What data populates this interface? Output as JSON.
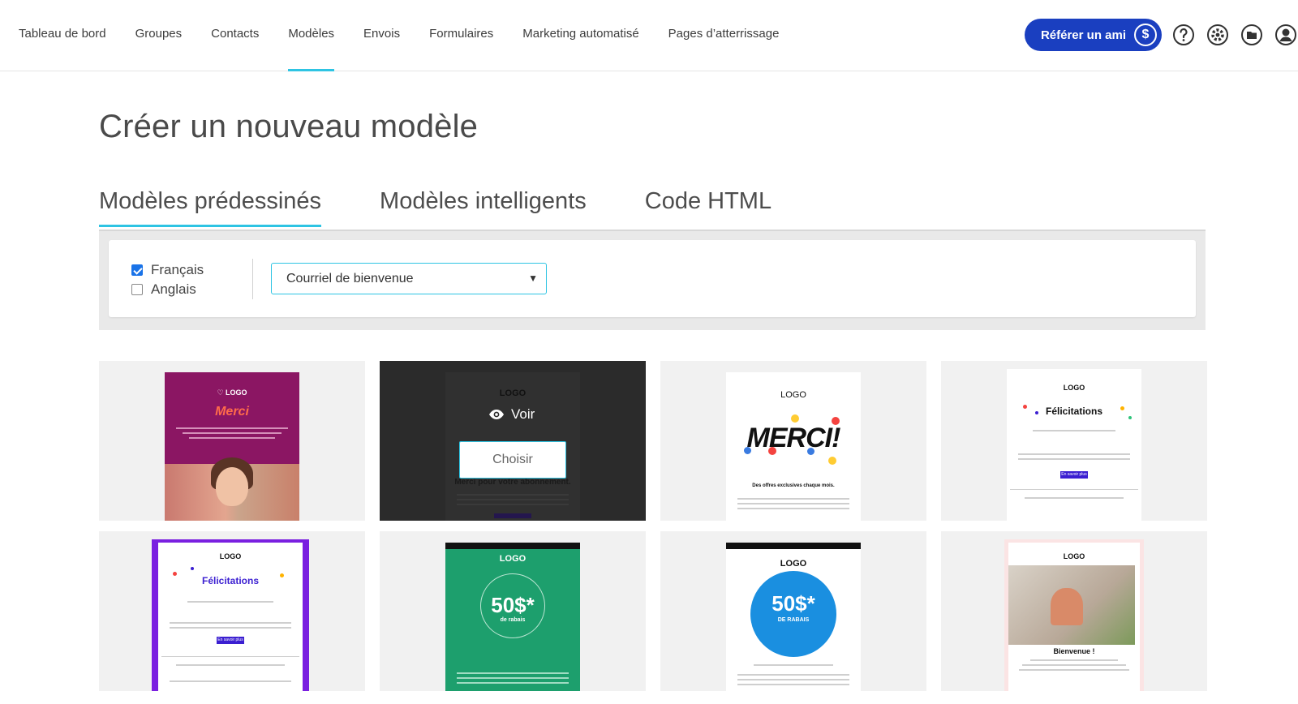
{
  "nav": {
    "items": [
      {
        "label": "Tableau de bord"
      },
      {
        "label": "Groupes"
      },
      {
        "label": "Contacts"
      },
      {
        "label": "Modèles",
        "active": true
      },
      {
        "label": "Envois"
      },
      {
        "label": "Formulaires"
      },
      {
        "label": "Marketing automatisé"
      },
      {
        "label": "Pages d’atterrissage"
      }
    ],
    "refer_label": "Référer un ami",
    "refer_symbol": "$",
    "icons": [
      "help-icon",
      "gear-icon",
      "folder-icon",
      "user-icon"
    ]
  },
  "page": {
    "title": "Créer un nouveau modèle"
  },
  "tabs": [
    {
      "label": "Modèles prédessinés",
      "active": true
    },
    {
      "label": "Modèles intelligents"
    },
    {
      "label": "Code HTML"
    }
  ],
  "filters": {
    "languages": [
      {
        "label": "Français",
        "checked": true
      },
      {
        "label": "Anglais",
        "checked": false
      }
    ],
    "category_selected": "Courriel de bienvenue"
  },
  "templates": {
    "hover_actions": {
      "view_label": "Voir",
      "choose_label": "Choisir"
    },
    "cards": [
      {
        "logo": "LOGO",
        "headline": "Merci"
      },
      {
        "logo": "LOGO",
        "headline": "Merci pour votre abonnement."
      },
      {
        "logo": "LOGO",
        "headline": "MERCI!",
        "sub": "Des offres exclusives chaque mois."
      },
      {
        "logo": "LOGO",
        "headline": "Félicitations",
        "cta": "En savoir plus"
      },
      {
        "logo": "LOGO",
        "headline": "Félicitations",
        "cta": "En savoir plus"
      },
      {
        "logo": "LOGO",
        "headline": "50$*",
        "sub": "de rabais"
      },
      {
        "logo": "LOGO",
        "headline": "50$*",
        "sub": "DE RABAIS"
      },
      {
        "logo": "LOGO",
        "headline": "Bienvenue !"
      }
    ]
  },
  "colors": {
    "accent": "#2ec4e3",
    "primary_button": "#1a3fc0",
    "checkbox": "#1a73e8"
  }
}
